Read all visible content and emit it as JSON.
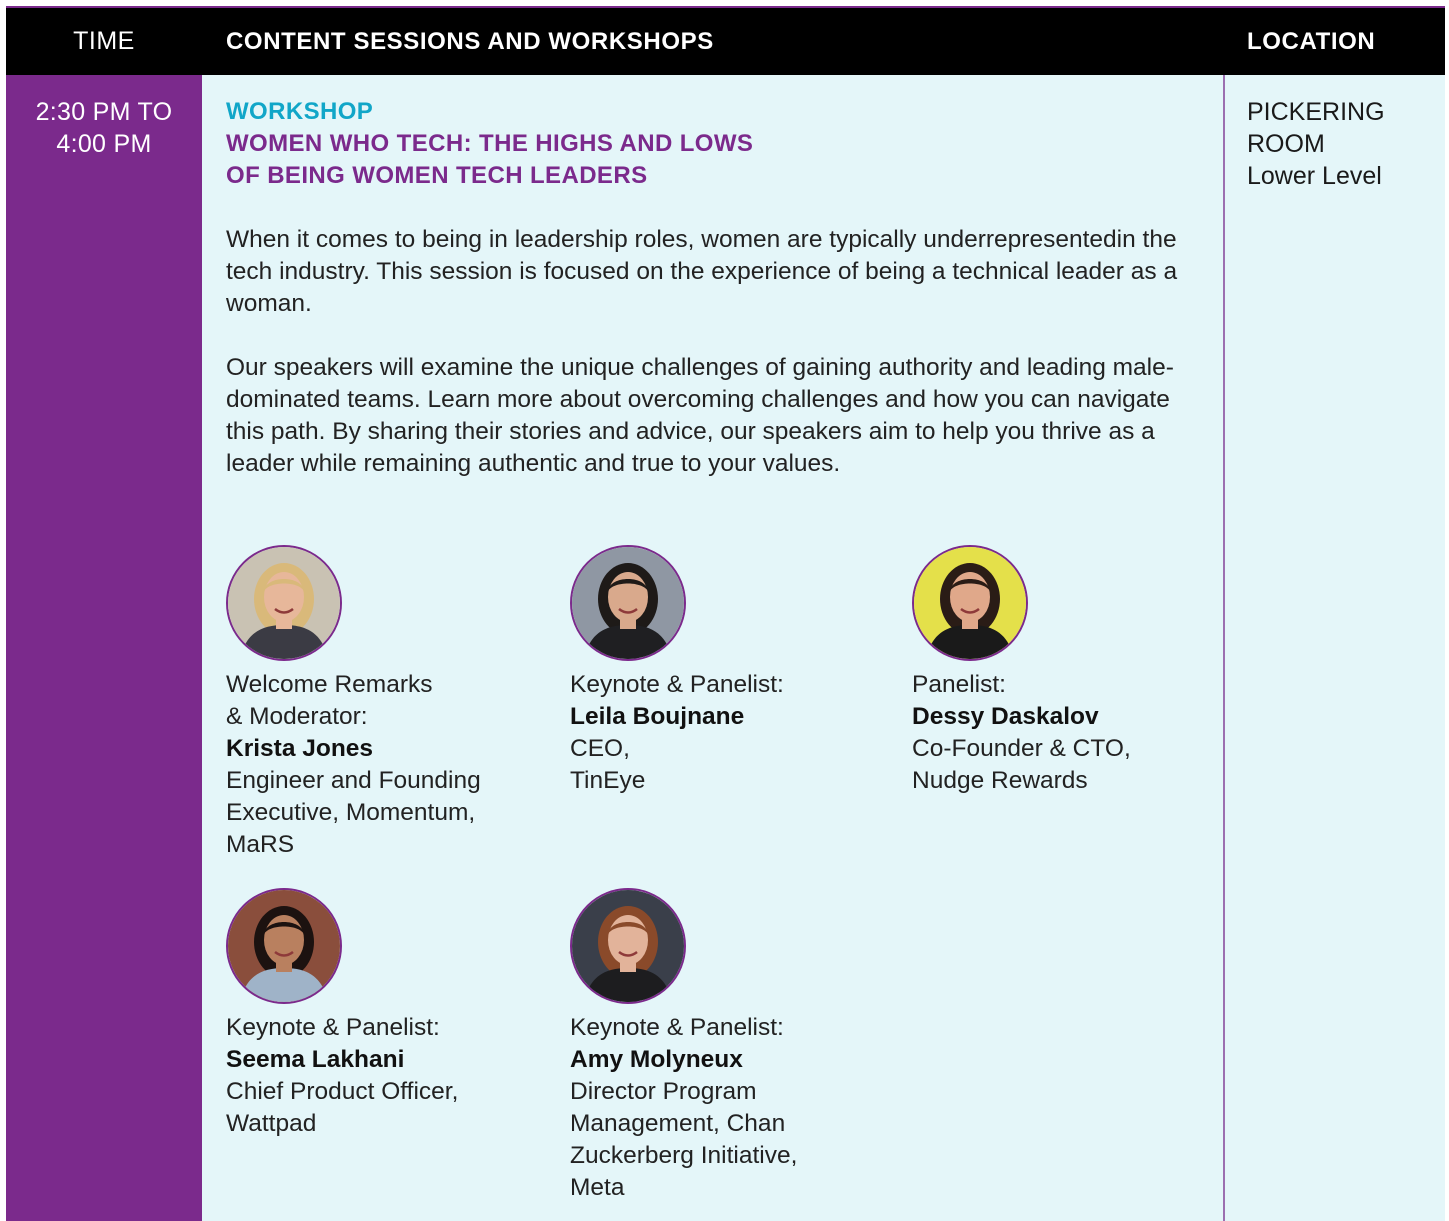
{
  "header": {
    "time": "TIME",
    "sessions": "CONTENT SESSIONS AND WORKSHOPS",
    "location": "LOCATION"
  },
  "time": {
    "line1": "2:30 PM TO",
    "line2": "4:00 PM"
  },
  "session": {
    "kicker": "WORKSHOP",
    "title_line1": "WOMEN WHO TECH: THE HIGHS AND LOWS",
    "title_line2": "OF BEING WOMEN TECH LEADERS",
    "description": [
      "When it comes to being in leadership roles, women are typically underrepresentedin the tech industry. This session is focused on the experience of being a technical leader as a woman.",
      "Our speakers will examine the unique challenges of gaining authority and leading male-dominated teams. Learn more about overcoming challenges and how you can navigate this path. By sharing their stories and advice, our speakers aim to help you thrive as a leader while remaining authentic and true to your values."
    ]
  },
  "location": {
    "line1": "PICKERING",
    "line2": "ROOM",
    "line3": "Lower Level"
  },
  "speakers": [
    {
      "role_line1": "Welcome Remarks",
      "role_line2": "& Moderator:",
      "name": "Krista Jones",
      "detail_lines": [
        "Engineer and Founding",
        "Executive, Momentum,",
        "MaRS"
      ],
      "photo": "portrait-blonde-woman",
      "colors": {
        "bg": "#c9c2b3",
        "skin": "#e7b79a",
        "hair": "#d9b97a",
        "top": "#3b3b44"
      }
    },
    {
      "role_line1": "Keynote & Panelist:",
      "role_line2": "",
      "name": "Leila Boujnane",
      "detail_lines": [
        "CEO,",
        "TinEye"
      ],
      "photo": "portrait-short-hair-glasses",
      "colors": {
        "bg": "#8f97a3",
        "skin": "#d9a98c",
        "hair": "#1e1a18",
        "top": "#1f1f22"
      }
    },
    {
      "role_line1": "Panelist:",
      "role_line2": "",
      "name": "Dessy Daskalov",
      "detail_lines": [
        "Co-Founder & CTO,",
        "Nudge Rewards"
      ],
      "photo": "portrait-yellow-background",
      "colors": {
        "bg": "#e4e04a",
        "skin": "#e0a88a",
        "hair": "#2a1c16",
        "top": "#1a1a1a"
      }
    },
    {
      "role_line1": "Keynote & Panelist:",
      "role_line2": "",
      "name": "Seema Lakhani",
      "detail_lines": [
        "Chief Product Officer,",
        "Wattpad"
      ],
      "photo": "portrait-brick-background",
      "colors": {
        "bg": "#8a4e3c",
        "skin": "#b9805f",
        "hair": "#1c1210",
        "top": "#9fb3c8"
      }
    },
    {
      "role_line1": "Keynote & Panelist:",
      "role_line2": "",
      "name": "Amy Molyneux",
      "detail_lines": [
        "Director Program",
        "Management, Chan",
        "Zuckerberg Initiative,",
        "Meta"
      ],
      "photo": "portrait-red-hair-glasses",
      "colors": {
        "bg": "#3a3f4a",
        "skin": "#e2b39a",
        "hair": "#8a4a2a",
        "top": "#1d1d1f"
      }
    }
  ]
}
